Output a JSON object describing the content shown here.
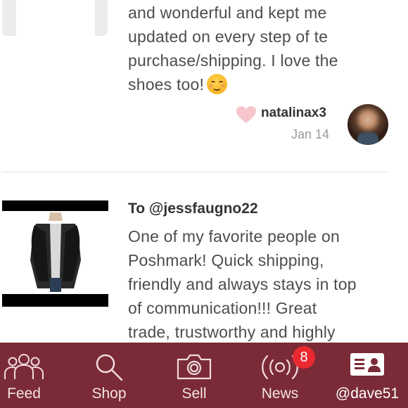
{
  "reviews": [
    {
      "text_lines": [
        "and wonderful and kept me",
        "updated on every step of te",
        "purchase/shipping. I love the",
        "shoes too!"
      ],
      "emoji": "relieved-smile-emoji",
      "author": "natalinax3",
      "date": "Jan 14",
      "liked": false
    },
    {
      "to": "To @jessfaugno22",
      "text_lines": [
        "One of my favorite people on",
        "Poshmark! Quick shipping,",
        "friendly and always stays in top",
        "of communication!!! Great",
        "trade, trustworthy and highly"
      ]
    }
  ],
  "tabs": [
    {
      "label": "Feed",
      "icon": "feed-people-icon"
    },
    {
      "label": "Shop",
      "icon": "search-icon"
    },
    {
      "label": "Sell",
      "icon": "camera-icon"
    },
    {
      "label": "News",
      "icon": "broadcast-icon",
      "badge": "8"
    },
    {
      "label": "@dave51",
      "icon": "profile-card-icon",
      "active": true
    }
  ],
  "colors": {
    "tabbar": "#7a2b37",
    "badge": "#e9292f",
    "heart": "#f7c6cc"
  }
}
